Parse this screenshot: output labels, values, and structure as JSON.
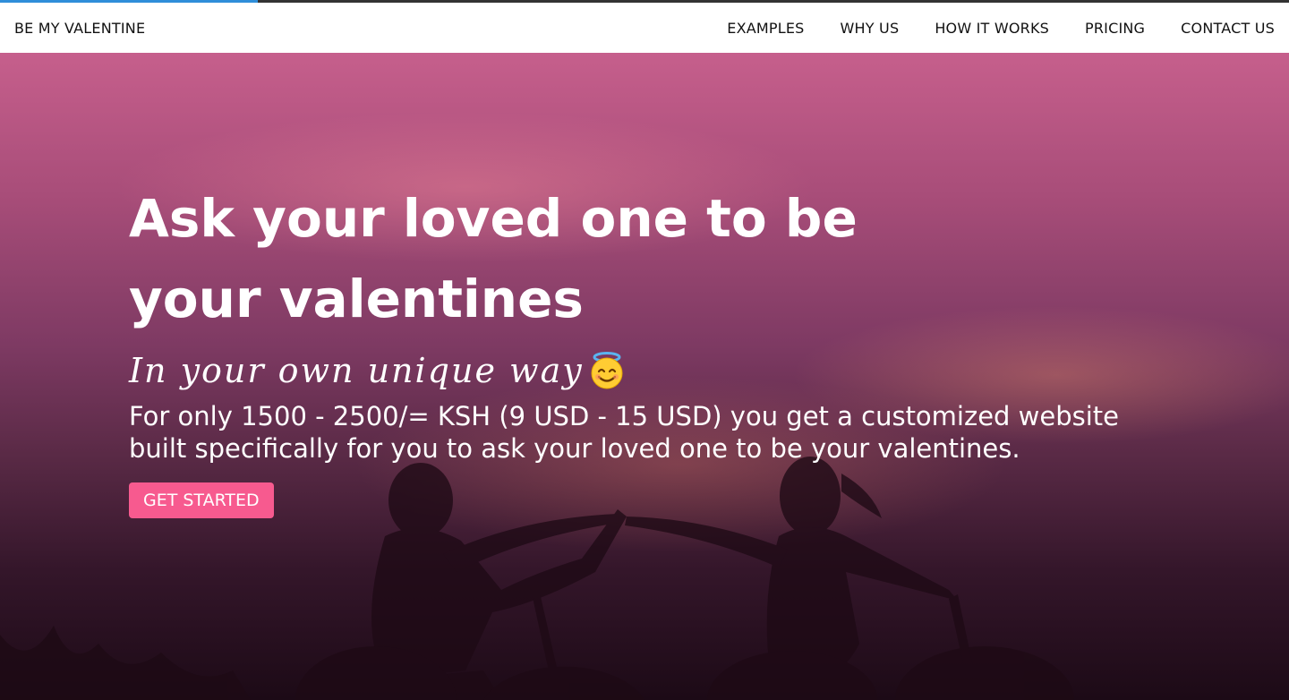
{
  "header": {
    "brand": "BE MY VALENTINE",
    "nav": [
      {
        "label": "EXAMPLES"
      },
      {
        "label": "WHY US"
      },
      {
        "label": "HOW IT WORKS"
      },
      {
        "label": "PRICING"
      },
      {
        "label": "CONTACT US"
      }
    ],
    "scroll_progress_fraction": 0.2
  },
  "hero": {
    "headline": "Ask your loved one to be your valentines",
    "tagline": "In your own unique way",
    "tagline_emoji": "smiling-face-with-halo-icon",
    "description": "For only 1500 - 2500/= KSH (9 USD - 15 USD) you get a customized website built specifically for you to ask your loved one to be your valentines.",
    "cta_label": "GET STARTED"
  },
  "colors": {
    "accent": "#f75a8f",
    "progress_bar": "#2f8ed9",
    "nav_bg": "#ffffff",
    "text_on_hero": "#ffffff"
  }
}
